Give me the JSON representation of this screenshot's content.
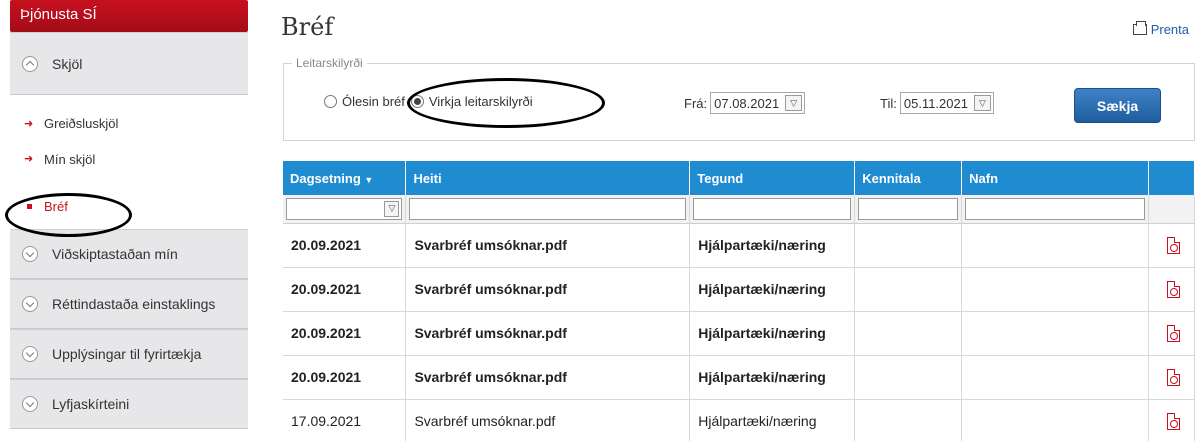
{
  "sidebar": {
    "header": "Þjónusta SÍ",
    "section_open": "Skjöl",
    "items": [
      {
        "label": "Greiðsluskjöl",
        "active": false
      },
      {
        "label": "Mín skjöl",
        "active": false
      },
      {
        "label": "Bréf",
        "active": true
      }
    ],
    "sections": [
      "Viðskiptastaðan mín",
      "Réttindastaða einstaklings",
      "Upplýsingar til fyrirtækja",
      "Lyfjaskírteini"
    ]
  },
  "page": {
    "title": "Bréf",
    "print_label": "Prenta"
  },
  "filters": {
    "legend": "Leitarskilyrði",
    "radio_unread": "Ólesin bréf",
    "radio_active": "Virkja leitarskilyrði",
    "from_label": "Frá:",
    "from_value": "07.08.2021",
    "to_label": "Til:",
    "to_value": "05.11.2021",
    "search_button": "Sækja"
  },
  "table": {
    "columns": [
      "Dagsetning",
      "Heiti",
      "Tegund",
      "Kennitala",
      "Nafn"
    ],
    "rows": [
      {
        "date": "20.09.2021",
        "name": "Svarbréf umsóknar.pdf",
        "type": "Hjálpartæki/næring",
        "kennitala": "",
        "nafn": "",
        "unread": true
      },
      {
        "date": "20.09.2021",
        "name": "Svarbréf umsóknar.pdf",
        "type": "Hjálpartæki/næring",
        "kennitala": "",
        "nafn": "",
        "unread": true
      },
      {
        "date": "20.09.2021",
        "name": "Svarbréf umsóknar.pdf",
        "type": "Hjálpartæki/næring",
        "kennitala": "",
        "nafn": "",
        "unread": true
      },
      {
        "date": "20.09.2021",
        "name": "Svarbréf umsóknar.pdf",
        "type": "Hjálpartæki/næring",
        "kennitala": "",
        "nafn": "",
        "unread": true
      },
      {
        "date": "17.09.2021",
        "name": "Svarbréf umsóknar.pdf",
        "type": "Hjálpartæki/næring",
        "kennitala": "",
        "nafn": "",
        "unread": false
      }
    ]
  },
  "colors": {
    "brand_red": "#c8101f",
    "header_blue": "#1f8bd1",
    "button_blue": "#2a6db3"
  }
}
